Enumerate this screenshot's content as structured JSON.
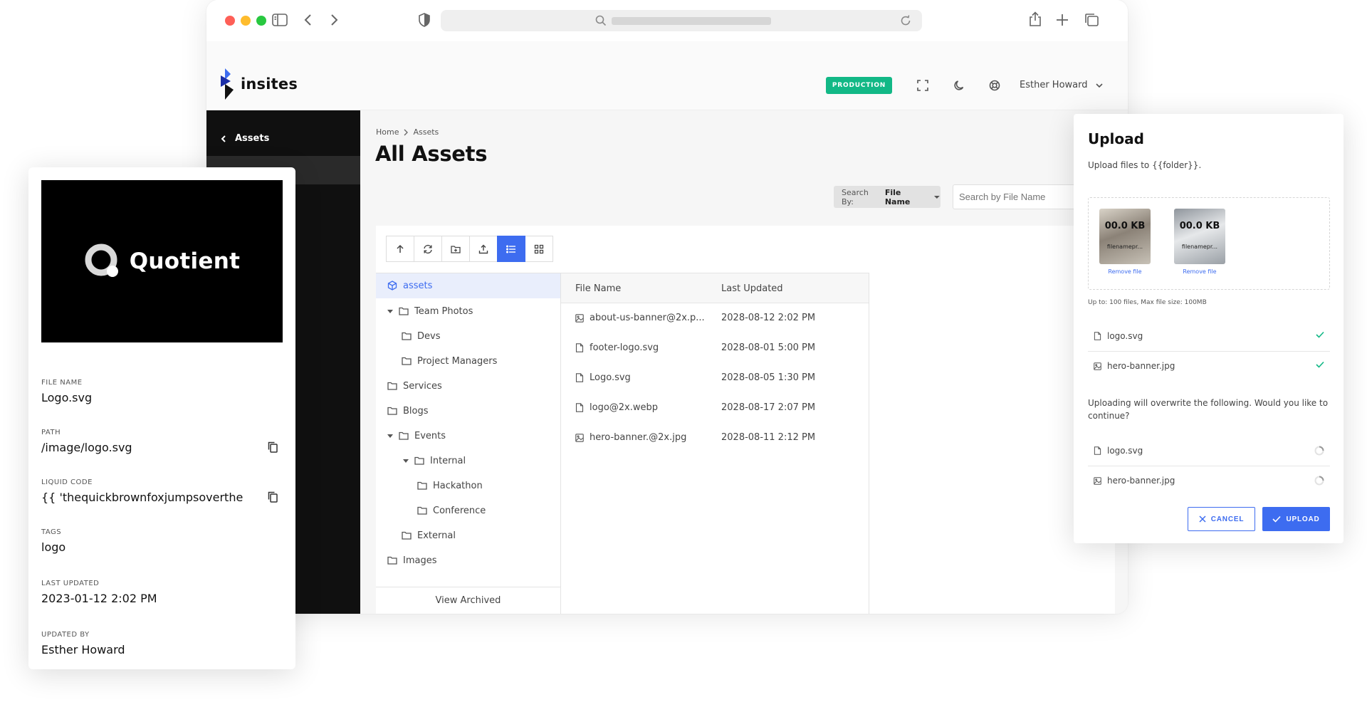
{
  "app": {
    "brand": "insites",
    "environment": "PRODUCTION",
    "user_name": "Esther Howard"
  },
  "sidebar": {
    "back_label": "Assets"
  },
  "main": {
    "breadcrumb": [
      "Home",
      "Assets"
    ],
    "title": "All Assets",
    "search_by_label": "Search By:",
    "search_by_value": "File Name",
    "search_placeholder": "Search by File Name"
  },
  "tree": {
    "items": [
      {
        "label": "assets",
        "icon": "cube-icon",
        "selected": true
      },
      {
        "label": "Team Photos",
        "icon": "folder-icon",
        "expanded": true
      },
      {
        "label": "Devs",
        "icon": "folder-icon"
      },
      {
        "label": "Project Managers",
        "icon": "folder-icon"
      },
      {
        "label": "Services",
        "icon": "folder-icon"
      },
      {
        "label": "Blogs",
        "icon": "folder-icon"
      },
      {
        "label": "Events",
        "icon": "folder-icon",
        "expanded": true
      },
      {
        "label": "Internal",
        "icon": "folder-icon",
        "expanded": true
      },
      {
        "label": "Hackathon",
        "icon": "folder-icon"
      },
      {
        "label": "Conference",
        "icon": "folder-icon"
      },
      {
        "label": "External",
        "icon": "folder-icon"
      },
      {
        "label": "Images",
        "icon": "folder-icon"
      }
    ],
    "view_archived": "View Archived"
  },
  "files": {
    "columns": [
      "File Name",
      "Last Updated"
    ],
    "rows": [
      {
        "name": "about-us-banner@2x.p...",
        "updated": "2028-08-12 2:02 PM",
        "icon": "image-icon"
      },
      {
        "name": "footer-logo.svg",
        "updated": "2028-08-01 5:00 PM",
        "icon": "file-icon"
      },
      {
        "name": "Logo.svg",
        "updated": "2028-08-05 1:30 PM",
        "icon": "file-icon"
      },
      {
        "name": "logo@2x.webp",
        "updated": "2028-08-17 2:07 PM",
        "icon": "file-icon"
      },
      {
        "name": "hero-banner.@2x.jpg",
        "updated": "2028-08-11 2:12 PM",
        "icon": "image-icon"
      }
    ]
  },
  "detail": {
    "preview_brand": "Quotient",
    "fields": [
      {
        "label": "FILE NAME",
        "value": "Logo.svg"
      },
      {
        "label": "PATH",
        "value": "/image/logo.svg"
      },
      {
        "label": "LIQUID CODE",
        "value": "{{ 'thequickbrownfoxjumpsoverthe"
      },
      {
        "label": "TAGS",
        "value": "logo"
      },
      {
        "label": "LAST UPDATED",
        "value": "2023-01-12 2:02 PM"
      },
      {
        "label": "UPDATED BY",
        "value": "Esther Howard"
      }
    ]
  },
  "upload": {
    "title": "Upload",
    "subtitle": "Upload files to {{folder}}.",
    "thumbs": [
      {
        "size": "00.0 KB",
        "name": "filenamepr...",
        "remove": "Remove file"
      },
      {
        "size": "00.0 KB",
        "name": "filenamepr...",
        "remove": "Remove file"
      }
    ],
    "limit": "Up to: 100 files, Max file size: 100MB",
    "uploaded": [
      "logo.svg",
      "hero-banner.jpg"
    ],
    "warning": "Uploading will overwrite the following. Would you like to continue?",
    "overwrite": [
      "logo.svg",
      "hero-banner.jpg"
    ],
    "cancel_label": "CANCEL",
    "upload_label": "UPLOAD"
  },
  "colors": {
    "accent": "#3d6cf0",
    "environment_badge": "#12b886",
    "sidebar": "#101010"
  }
}
